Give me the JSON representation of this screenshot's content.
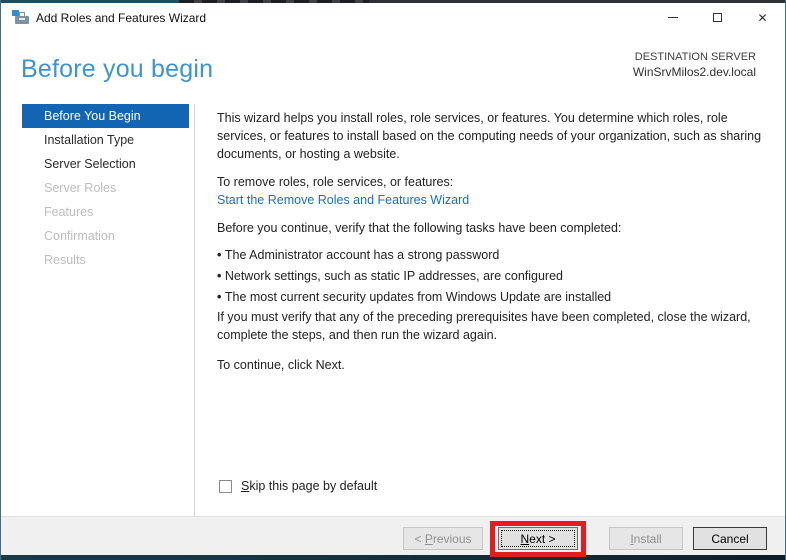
{
  "colors": {
    "accent": "#1165b2",
    "header_title": "#3d95d0",
    "link": "#1a6fc4",
    "annotation": "#e31b23",
    "top_teal": "#1d4f66",
    "bottom_strip": "#15323e"
  },
  "window": {
    "title": "Add Roles and Features Wizard",
    "close_icon": "✕"
  },
  "header": {
    "title": "Before you begin",
    "destination_label": "DESTINATION SERVER",
    "destination_server": "WinSrvMilos2.dev.local"
  },
  "sidebar": {
    "items": [
      {
        "label": "Before You Begin",
        "state": "active"
      },
      {
        "label": "Installation Type",
        "state": "enabled"
      },
      {
        "label": "Server Selection",
        "state": "enabled"
      },
      {
        "label": "Server Roles",
        "state": "disabled"
      },
      {
        "label": "Features",
        "state": "disabled"
      },
      {
        "label": "Confirmation",
        "state": "disabled"
      },
      {
        "label": "Results",
        "state": "disabled"
      }
    ]
  },
  "content": {
    "intro": "This wizard helps you install roles, role services, or features. You determine which roles, role services, or features to install based on the computing needs of your organization, such as sharing documents, or hosting a website.",
    "remove_label": "To remove roles, role services, or features:",
    "remove_link": "Start the Remove Roles and Features Wizard",
    "verify_intro": "Before you continue, verify that the following tasks have been completed:",
    "bullets": [
      "The Administrator account has a strong password",
      "Network settings, such as static IP addresses, are configured",
      "The most current security updates from Windows Update are installed"
    ],
    "prereq_note": "If you must verify that any of the preceding prerequisites have been completed, close the wizard, complete the steps, and then run the wizard again.",
    "continue_note": "To continue, click Next.",
    "skip_checkbox": {
      "key": "S",
      "rest": "kip this page by default",
      "checked": false
    }
  },
  "footer": {
    "previous": {
      "pre": "< ",
      "key": "P",
      "rest": "revious"
    },
    "next": {
      "pre": "",
      "key": "N",
      "rest": "ext >"
    },
    "install": {
      "pre": "",
      "key": "I",
      "rest": "nstall"
    },
    "cancel": {
      "label": "Cancel"
    }
  }
}
